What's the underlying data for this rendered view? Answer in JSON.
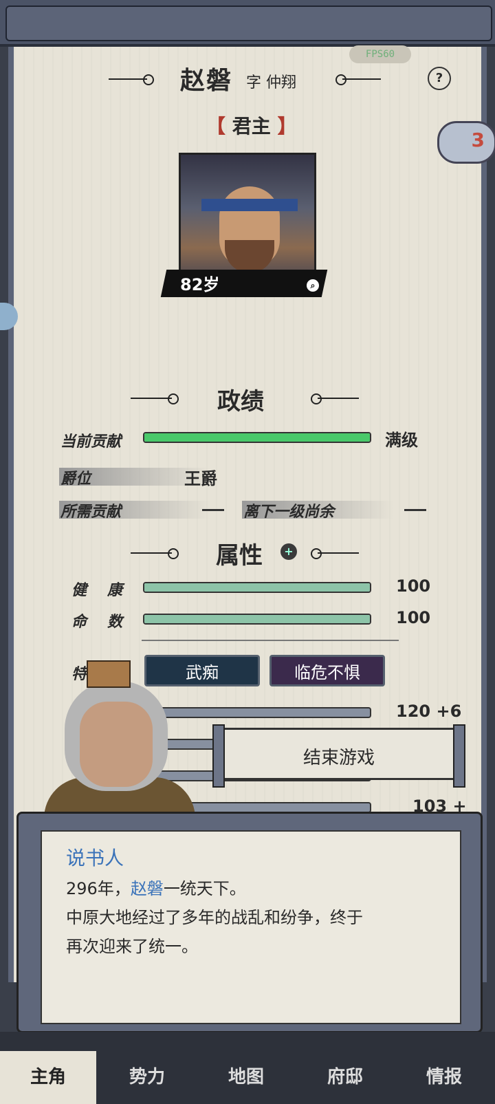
{
  "hud": {
    "fps": "FPS60",
    "help": "?",
    "cloud_count": "3"
  },
  "character": {
    "name": "赵磐",
    "courtesy": "字 仲翔",
    "role_open": "【",
    "role": "君主",
    "role_close": "】",
    "age": "82岁"
  },
  "performance": {
    "title": "政绩",
    "contribution_label": "当前贡献",
    "contribution_fraction": 1.0,
    "contribution_value": "满级",
    "rank_label": "爵位",
    "rank_value": "王爵",
    "needed_label": "所需贡献",
    "next_label": "离下一级尚余"
  },
  "attributes": {
    "title": "属性",
    "health_label": "健康",
    "health_value": "100",
    "life_label": "命数",
    "life_value": "100",
    "traits_label": "特",
    "traits": [
      "武痴",
      "临危不惧"
    ],
    "stats": [
      {
        "value": "120 +6",
        "fraction": 0.95
      },
      {
        "value": "",
        "fraction": 0.7
      },
      {
        "value": "",
        "fraction": 0.6
      },
      {
        "value": "103 +",
        "fraction": 0.85
      }
    ]
  },
  "end_game": {
    "label": "结束游戏"
  },
  "dialog": {
    "speaker": "说书人",
    "line1_pre": "296年，",
    "line1_name": "赵磐",
    "line1_post": "一统天下。",
    "line2": "中原大地经过了多年的战乱和纷争，终于",
    "line3": "再次迎来了统一。"
  },
  "tabs": [
    "主角",
    "势力",
    "地图",
    "府邸",
    "情报"
  ],
  "colors": {
    "contribution": "#49c96a",
    "attr": "#8dc4a8",
    "highlight": "#3b73b9"
  }
}
